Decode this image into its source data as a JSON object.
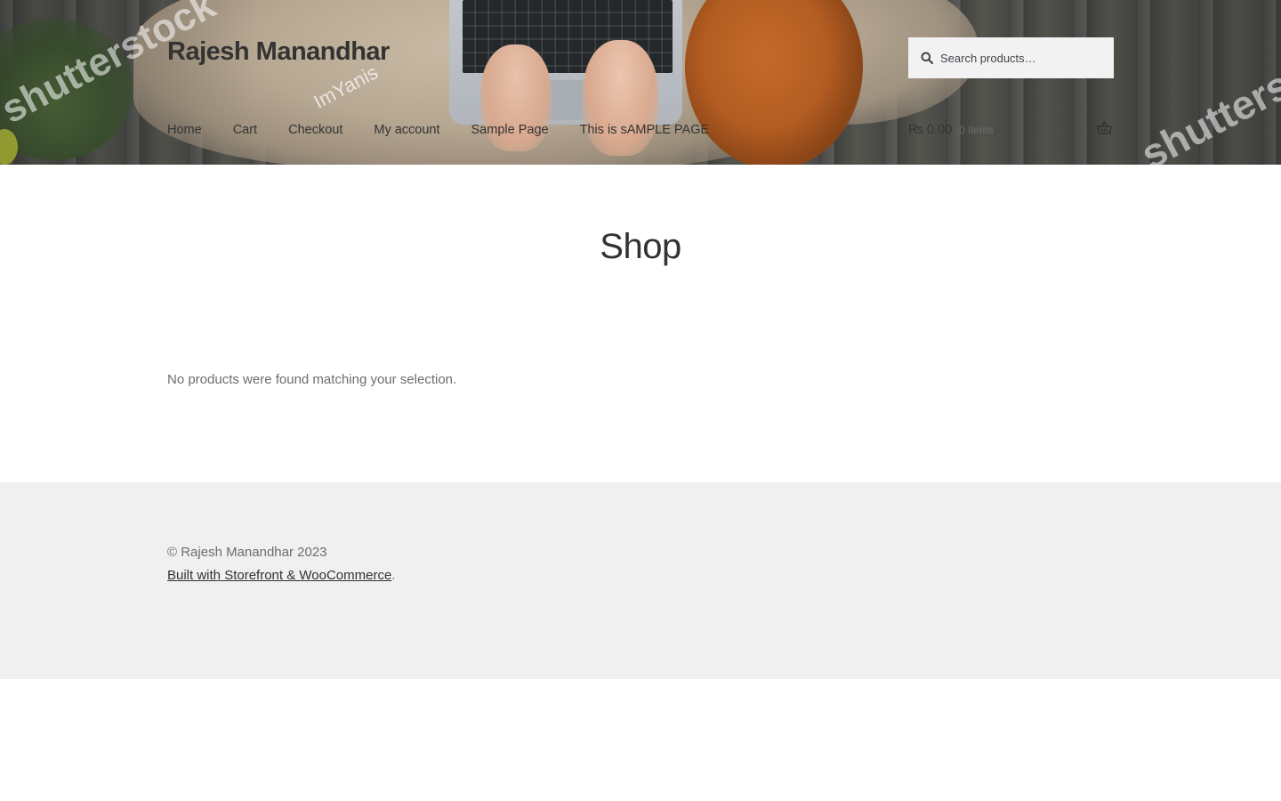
{
  "header": {
    "site_title": "Rajesh Manandhar",
    "watermarks": [
      "shutterstock",
      "shutterstock",
      "ImYanis"
    ],
    "search": {
      "placeholder": "Search products…"
    },
    "nav": [
      {
        "label": "Home"
      },
      {
        "label": "Cart"
      },
      {
        "label": "Checkout"
      },
      {
        "label": "My account"
      },
      {
        "label": "Sample Page"
      },
      {
        "label": "This is sAMPLE PAGE"
      }
    ],
    "cart": {
      "amount": "₨ 0.00",
      "count": "0 items"
    }
  },
  "main": {
    "page_title": "Shop",
    "empty_message": "No products were found matching your selection."
  },
  "footer": {
    "copyright": "© Rajesh Manandhar 2023",
    "credit_link": "Built with Storefront & WooCommerce",
    "credit_suffix": "."
  },
  "colors": {
    "text_dark": "#333333",
    "text_body": "#6d6d6d",
    "footer_bg": "#f0f0f0",
    "search_bg": "#f2f2f2"
  }
}
